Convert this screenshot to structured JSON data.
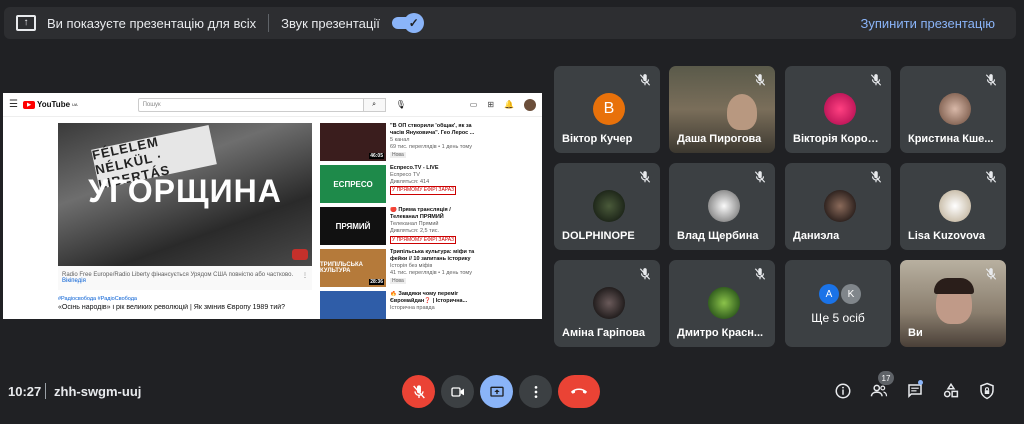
{
  "presenting_bar": {
    "message": "Ви показуєте презентацію для всіх",
    "audio_label": "Звук презентації",
    "audio_enabled": true,
    "stop_label": "Зупинити презентацію"
  },
  "shared_screen": {
    "search_placeholder": "Пошук",
    "logo_text": "YouTube",
    "logo_region": "UA",
    "main_video": {
      "banner_text": "FÉLELEM NÉLKÜL · LIBERTÁS",
      "headline": "УГОРЩИНА",
      "caption": "Radio Free Europe/Radio Liberty фінансується Урядом США повністю або частково.",
      "caption_more": "Вікіпедія",
      "tags": "#Радіосвобода #РадіоСвобода",
      "title": "«Осінь народів» і рік великих революцій | Як змінив Європу 1989 тий?"
    },
    "recommendations": [
      {
        "thumb_text": "",
        "duration": "46:05",
        "title": "\"В ОП створили 'общак', як за часів Януковича\". Гео Лерос ...",
        "channel": "5 канал",
        "meta": "69 тис. переглядів • 1 день тому",
        "badge": "Нова"
      },
      {
        "thumb_text": "ЕСПРЕСО",
        "duration": "",
        "title": "Еспресо.TV - LIVE",
        "channel": "Еспресо TV",
        "meta": "Дивляться: 414",
        "live": "У ПРЯМОМУ ЕФІРІ ЗАРАЗ"
      },
      {
        "thumb_text": "ПРЯМИЙ",
        "duration": "",
        "title": "🔴 Пряма трансляція / Телеканал ПРЯМИЙ",
        "channel": "Телеканал Прямий",
        "meta": "Дивляться: 2,5 тис.",
        "live": "У ПРЯМОМУ ЕФІРІ ЗАРАЗ"
      },
      {
        "thumb_text": "ТРИПІЛЬСЬКА КУЛЬТУРА",
        "duration": "28:36",
        "title": "Трипільська культура: міфи та фейки // 10 запитань історику",
        "channel": "Історія без міфів",
        "meta": "41 тис. переглядів • 1 день тому",
        "badge": "Нова"
      },
      {
        "thumb_text": "",
        "duration": "",
        "title": "🔥 Завдяки чому переміг Євромайдан❓ | Історична...",
        "channel": "Історична правда",
        "meta": "",
        "badge": ""
      }
    ]
  },
  "participants": [
    {
      "name": "Віктор Кучер",
      "initial": "В",
      "avatar_color": "#e8710a",
      "type": "initial",
      "muted": true
    },
    {
      "name": "Даша Пирогова",
      "type": "video",
      "muted": true
    },
    {
      "name": "Вікторія Коровій",
      "type": "photo",
      "photo_color": "#e91e63",
      "muted": true
    },
    {
      "name": "Кристина Кше...",
      "type": "photo",
      "photo_color": "#b08a78",
      "muted": true
    },
    {
      "name": "DOLPHINOPE",
      "type": "photo",
      "photo_color": "#2e3d2a",
      "muted": true
    },
    {
      "name": "Влад Щербина",
      "type": "photo",
      "photo_color": "#d7d7d7",
      "muted": true
    },
    {
      "name": "Даниэла",
      "type": "photo",
      "photo_color": "#4a3a34",
      "muted": true
    },
    {
      "name": "Lisa Kuzovova",
      "type": "photo",
      "photo_color": "#efe6d8",
      "muted": true
    },
    {
      "name": "Аміна Гарі­пова",
      "display_name": "Аміна Гарiпова",
      "type": "photo",
      "photo_color": "#3b3536",
      "muted": true
    },
    {
      "name": "Дмитро Красн...",
      "type": "photo",
      "photo_color": "#3f7a2c",
      "muted": true
    },
    {
      "name": "Ще 5 осіб",
      "type": "others",
      "initials": [
        "A",
        "K"
      ],
      "colors": [
        "#1a73e8",
        "#5f6368"
      ]
    },
    {
      "name": "Ви",
      "type": "video_self",
      "muted": true
    }
  ],
  "bottom_bar": {
    "time": "10:27",
    "meeting_code": "zhh-swgm-uuj",
    "participant_count": "17"
  }
}
